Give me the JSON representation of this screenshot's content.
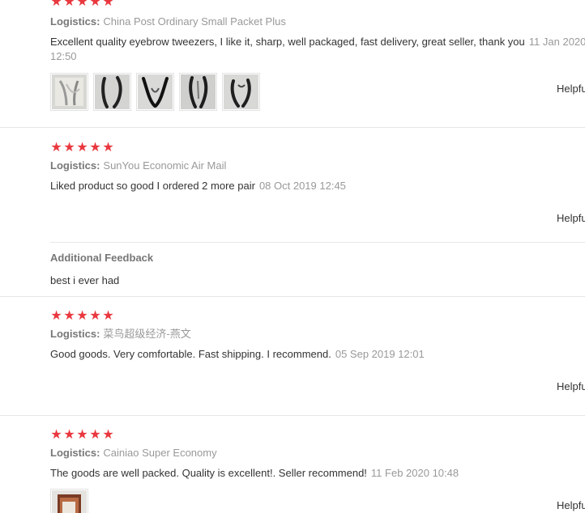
{
  "reviews": [
    {
      "rating": 5,
      "logistics_label": "Logistics:",
      "logistics_value": "China Post Ordinary Small Packet Plus",
      "comment": "Excellent quality eyebrow tweezers, I like it, sharp, well packaged, fast delivery, great seller, thank you",
      "date": "11 Jan 2020 12:50",
      "helpful_label": "Helpful?",
      "photos": [
        "tweezers-photo-1",
        "tweezers-photo-2",
        "tweezers-photo-3",
        "tweezers-photo-4",
        "tweezers-photo-5"
      ]
    },
    {
      "rating": 5,
      "logistics_label": "Logistics:",
      "logistics_value": "SunYou Economic Air Mail",
      "comment": "Liked product so good I ordered 2 more pair",
      "date": "08 Oct 2019 12:45",
      "helpful_label": "Helpful?",
      "photos": []
    },
    {
      "rating": 5,
      "logistics_label": "Logistics:",
      "logistics_value": "菜鸟超级经济-燕文",
      "comment": "Good goods. Very comfortable. Fast shipping. I recommend.",
      "date": "05 Sep 2019 12:01",
      "helpful_label": "Helpful?",
      "photos": []
    },
    {
      "rating": 5,
      "logistics_label": "Logistics:",
      "logistics_value": "Cainiao Super Economy",
      "comment": "The goods are well packed. Quality is excellent!. Seller recommend!",
      "date": "11 Feb 2020 10:48",
      "helpful_label": "Helpful?",
      "photos": [
        "package-photo-1"
      ]
    }
  ],
  "additional_feedback": {
    "title": "Additional Feedback",
    "text": "best i ever had"
  },
  "colors": {
    "star": "#e9383f",
    "muted_text": "#999999",
    "label_text": "#777777",
    "body_text": "#333333",
    "divider": "#e6e6e6"
  }
}
